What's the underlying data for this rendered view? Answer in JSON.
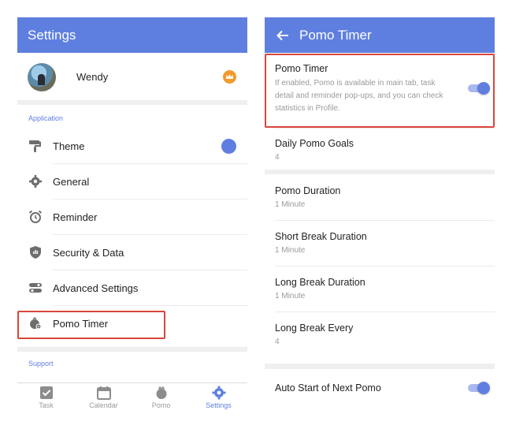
{
  "left_screen": {
    "appbar_title": "Settings",
    "profile": {
      "name": "Wendy"
    },
    "application_section_label": "Application",
    "menu": [
      {
        "label": "Theme",
        "icon": "paint-roller-icon"
      },
      {
        "label": "General",
        "icon": "gear-icon"
      },
      {
        "label": "Reminder",
        "icon": "alarm-clock-icon"
      },
      {
        "label": "Security & Data",
        "icon": "shield-icon"
      },
      {
        "label": "Advanced Settings",
        "icon": "toggles-icon"
      },
      {
        "label": "Pomo Timer",
        "icon": "pomo-gear-icon"
      }
    ],
    "support_section_label": "Support",
    "tabs": [
      {
        "label": "Task",
        "icon": "checkbox-icon"
      },
      {
        "label": "Calendar",
        "icon": "calendar-icon"
      },
      {
        "label": "Pomo",
        "icon": "pomo-icon"
      },
      {
        "label": "Settings",
        "icon": "settings-gear-icon",
        "active": true
      }
    ]
  },
  "right_screen": {
    "appbar_title": "Pomo Timer",
    "items": [
      {
        "title": "Pomo Timer",
        "subtitle": "If enabled, Pomo is available in main tab, task detail and reminder pop-ups, and you can check statistics in Profile.",
        "toggle": true
      },
      {
        "title": "Daily Pomo Goals",
        "subtitle": "4"
      },
      {
        "title": "Pomo Duration",
        "subtitle": "1 Minute"
      },
      {
        "title": "Short Break Duration",
        "subtitle": "1 Minute"
      },
      {
        "title": "Long Break Duration",
        "subtitle": "1 Minute"
      },
      {
        "title": "Long Break Every",
        "subtitle": "4"
      },
      {
        "title": "Auto Start of Next Pomo",
        "toggle": true
      }
    ]
  },
  "colors": {
    "accent": "#5f7fe0",
    "highlight": "#d9473c",
    "crown": "#f39a2b"
  }
}
